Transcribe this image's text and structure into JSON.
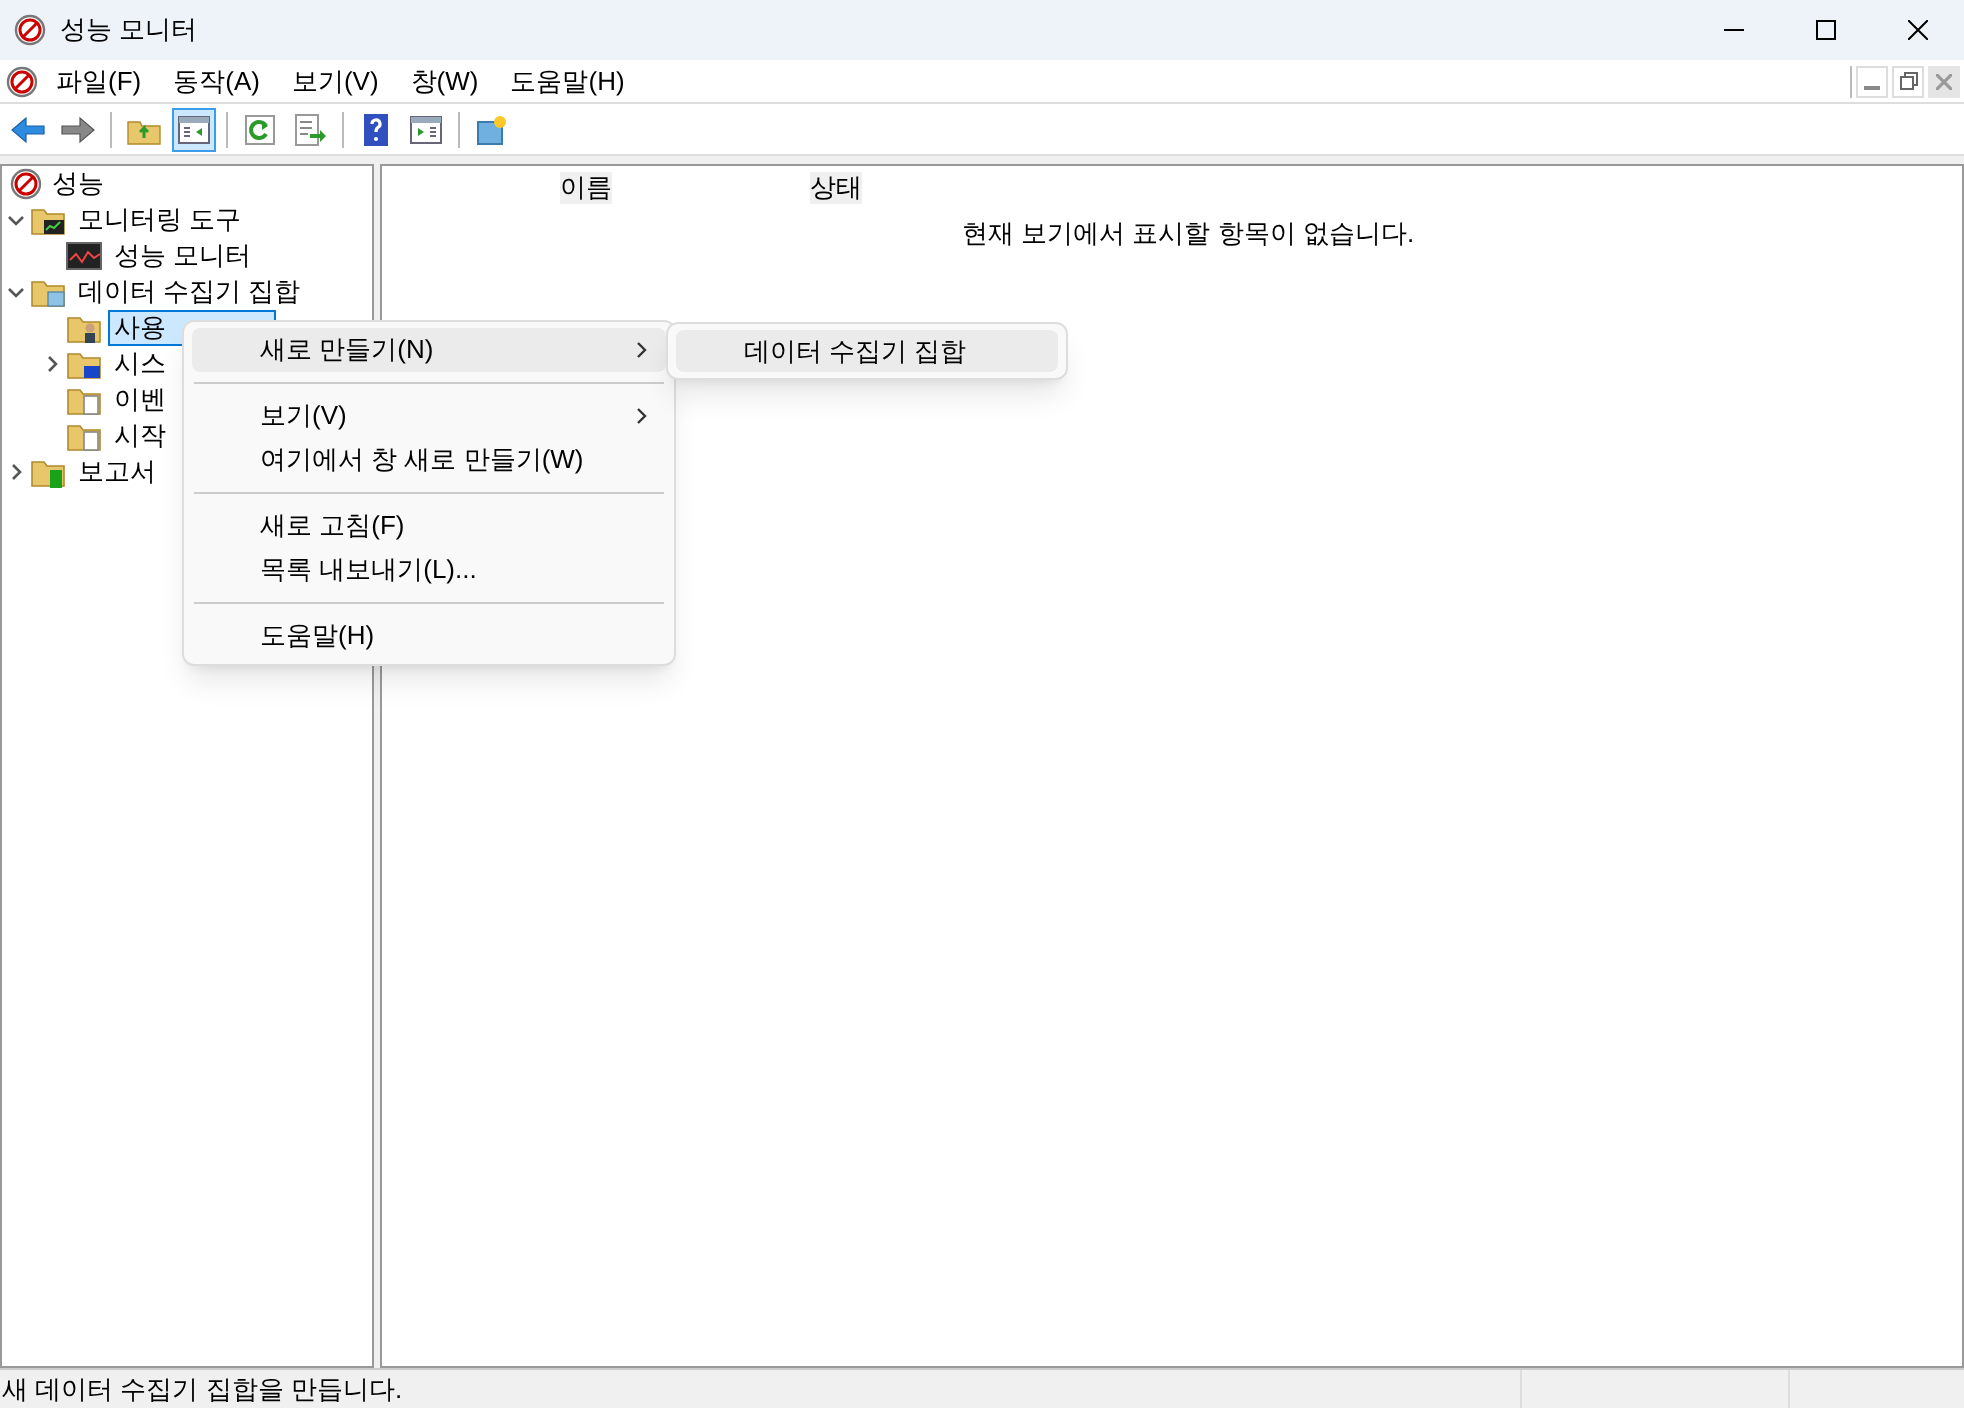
{
  "window": {
    "title": "성능 모니터"
  },
  "menu_bar": [
    {
      "label": "파일(F)"
    },
    {
      "label": "동작(A)"
    },
    {
      "label": "보기(V)"
    },
    {
      "label": "창(W)"
    },
    {
      "label": "도움말(H)"
    }
  ],
  "toolbar": [
    {
      "kind": "back",
      "selected": false
    },
    {
      "kind": "forward",
      "selected": false
    },
    {
      "kind": "sep"
    },
    {
      "kind": "up",
      "selected": false
    },
    {
      "kind": "tree",
      "selected": true
    },
    {
      "kind": "sep"
    },
    {
      "kind": "refresh",
      "selected": false
    },
    {
      "kind": "export",
      "selected": false
    },
    {
      "kind": "sep"
    },
    {
      "kind": "help",
      "selected": false
    },
    {
      "kind": "pane",
      "selected": false
    },
    {
      "kind": "sep"
    },
    {
      "kind": "new",
      "selected": false
    }
  ],
  "tree": [
    {
      "label": "성능",
      "kind": "perf",
      "selected": false,
      "children": [
        {
          "label": "모니터링 도구",
          "kind": "monitor-folder",
          "expanded": true,
          "selected": false,
          "children": [
            {
              "label": "성능 모니터",
              "kind": "graph",
              "selected": false
            }
          ]
        },
        {
          "label": "데이터 수집기 집합",
          "kind": "dcs-folder",
          "expanded": true,
          "selected": false,
          "children": [
            {
              "label": "사용",
              "kind": "user-folder",
              "selected": true
            },
            {
              "label": "시스",
              "kind": "system-folder",
              "expanded": false,
              "selected": false
            },
            {
              "label": "이벤",
              "kind": "doc-folder",
              "selected": false
            },
            {
              "label": "시작",
              "kind": "doc-folder",
              "selected": false
            }
          ]
        },
        {
          "label": "보고서",
          "kind": "report-folder",
          "expanded": false,
          "selected": false
        }
      ]
    }
  ],
  "list": {
    "columns": [
      "이름",
      "상태"
    ],
    "empty_message": "현재 보기에서 표시할 항목이 없습니다."
  },
  "context_menu": [
    {
      "kind": "item",
      "label": "새로 만들기(N)",
      "submenu": true,
      "selected": true
    },
    {
      "kind": "separator"
    },
    {
      "kind": "item",
      "label": "보기(V)",
      "submenu": true,
      "selected": false
    },
    {
      "kind": "item",
      "label": "여기에서 창 새로 만들기(W)",
      "submenu": false,
      "selected": false
    },
    {
      "kind": "separator"
    },
    {
      "kind": "item",
      "label": "새로 고침(F)",
      "submenu": false,
      "selected": false
    },
    {
      "kind": "item",
      "label": "목록 내보내기(L)...",
      "submenu": false,
      "selected": false
    },
    {
      "kind": "separator"
    },
    {
      "kind": "item",
      "label": "도움말(H)",
      "submenu": false,
      "selected": false
    }
  ],
  "submenu": [
    {
      "label": "데이터 수집기 집합",
      "selected": true
    }
  ],
  "status_bar": {
    "text": "새 데이터 수집기 집합을 만듭니다."
  }
}
